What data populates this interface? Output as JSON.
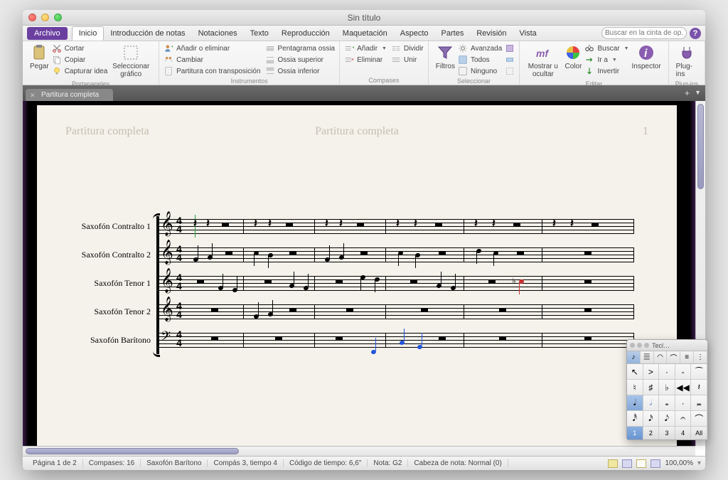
{
  "window": {
    "title": "Sin título"
  },
  "menubar": {
    "file": "Archivo",
    "tabs": [
      "Inicio",
      "Introducción de notas",
      "Notaciones",
      "Texto",
      "Reproducción",
      "Maquetación",
      "Aspecto",
      "Partes",
      "Revisión",
      "Vista"
    ],
    "active_tab": 0,
    "search_placeholder": "Buscar en la cinta de op…"
  },
  "ribbon": {
    "clipboard": {
      "paste": "Pegar",
      "cut": "Cortar",
      "copy": "Copiar",
      "capture": "Capturar idea",
      "select_graphic": "Seleccionar gráfico",
      "label": "Portapapeles"
    },
    "instruments": {
      "add_remove": "Añadir o eliminar",
      "change": "Cambiar",
      "transpose": "Partitura con transposición",
      "ossia": "Pentagrama ossia",
      "ossia_above": "Ossia superior",
      "ossia_below": "Ossia inferior",
      "label": "Instrumentos"
    },
    "bars": {
      "add": "Añadir",
      "remove": "Eliminar",
      "divide": "Dividir",
      "join": "Unir",
      "label": "Compases"
    },
    "selection": {
      "filters": "Filtros",
      "advanced": "Avanzada",
      "all": "Todos",
      "none": "Ninguno",
      "label": "Seleccionar"
    },
    "edit": {
      "show_hide": "Mostrar u ocultar",
      "color": "Color",
      "find": "Buscar",
      "goto": "Ir a",
      "invert": "Invertir",
      "inspector": "Inspector",
      "label": "Editar"
    },
    "plugins": {
      "plugins": "Plug-ins",
      "label": "Plug-ins"
    }
  },
  "doc_tab": "Partitura completa",
  "page": {
    "header_left": "Partitura completa",
    "header_center": "Partitura completa",
    "header_right": "1",
    "instruments": [
      "Saxofón Contralto 1",
      "Saxofón Contralto 2",
      "Saxofón Tenor 1",
      "Saxofón Tenor 2",
      "Saxofón Barítono"
    ],
    "time_signature": {
      "num": "4",
      "den": "4"
    }
  },
  "keypad": {
    "title": "Tecl…",
    "footer": [
      "1",
      "2",
      "3",
      "4",
      "All"
    ]
  },
  "statusbar": {
    "page": "Página 1 de 2",
    "bars": "Compases: 16",
    "instrument": "Saxofón Barítono",
    "bar_beat": "Compás 3, tiempo 4",
    "timecode": "Código de tiempo: 6,6\"",
    "note": "Nota: G2",
    "notehead": "Cabeza de nota: Normal (0)",
    "zoom": "100,00%"
  }
}
